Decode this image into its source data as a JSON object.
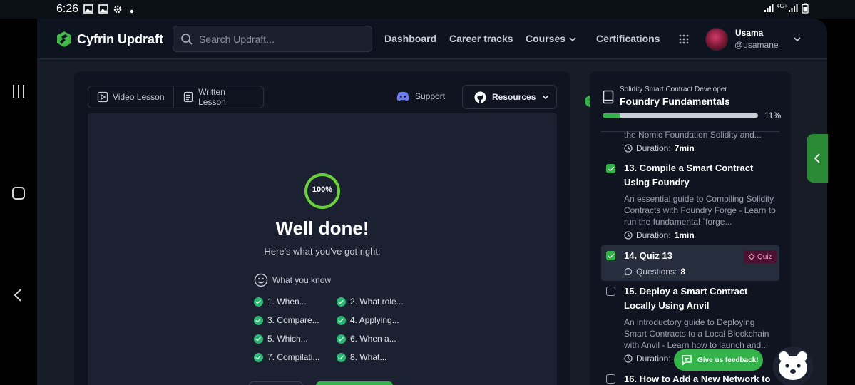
{
  "status_bar": {
    "time": "6:26",
    "network": "4G+",
    "notification_icons": [
      "gallery-icon",
      "gallery-icon",
      "gear-icon",
      "dot-icon"
    ]
  },
  "header": {
    "brand": "Cyfrin Updraft",
    "search_placeholder": "Search Updraft...",
    "nav": [
      "Dashboard",
      "Career tracks",
      "Courses",
      "Certifications"
    ],
    "user_name": "Usama",
    "user_handle": "@usamane"
  },
  "lesson": {
    "tabs": [
      "Video Lesson",
      "Written Lesson"
    ],
    "support_label": "Support",
    "resources_label": "Resources",
    "progress_label": "100%",
    "progress_value": 1.0,
    "title": "Well done!",
    "subtitle": "Here's what you've got right:",
    "know_label": "What you know",
    "answers": [
      "1. When...",
      "2. What role...",
      "3. Compare...",
      "4. Applying...",
      "5. Which...",
      "6. When a...",
      "7. Compilati...",
      "8. What..."
    ]
  },
  "course": {
    "track": "Solidity Smart Contract Developer",
    "name": "Foundry Fundamentals",
    "progress_label": "11%",
    "progress_value": 0.11,
    "top_desc": "the Nomic Foundation Solidity and...",
    "top_duration_label": "Duration:",
    "top_duration": "7min",
    "items": [
      {
        "title": "13. Compile a Smart Contract Using Foundry",
        "desc": "An essential guide to Compiling Solidity Contracts with Foundry Forge - Learn to run the fundamental `forge...",
        "meta_label": "Duration:",
        "meta_value": "1min",
        "completed": true
      },
      {
        "title": "14. Quiz 13",
        "badge": "Quiz",
        "meta_label": "Questions:",
        "meta_value": "8",
        "completed": true
      },
      {
        "title": "15. Deploy a Smart Contract Locally Using Anvil",
        "desc": "An introductory guide to Deploying Smart Contracts to a Local Blockchain with Anvil - Learn how to launch and...",
        "meta_label": "Duration:",
        "completed": false
      },
      {
        "title": "16. How to Add a New Network to",
        "completed": false
      }
    ]
  },
  "feedback": {
    "label": "Give us feedback!"
  },
  "colors": {
    "accent": "#34b34a",
    "background": "#171c27",
    "panel": "#0f1420",
    "quiz_badge": "#4a1230"
  }
}
